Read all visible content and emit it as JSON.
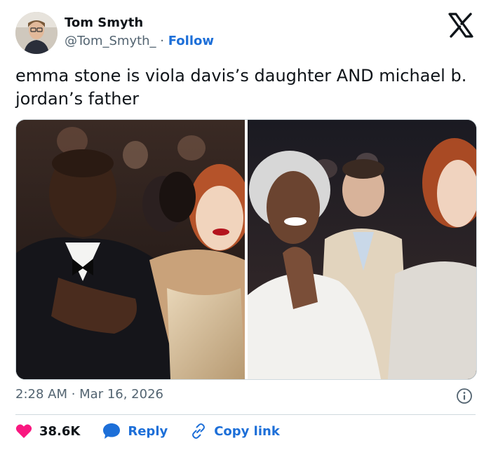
{
  "author": {
    "name": "Tom Smyth",
    "handle": "@Tom_Smyth_",
    "separator": " · ",
    "follow_label": "Follow"
  },
  "tweet": {
    "text": "emma stone is viola davis’s daughter AND michael b. jordan’s father"
  },
  "meta": {
    "timestamp": "2:28 AM · Mar 16, 2026"
  },
  "actions": {
    "like_count": "38.6K",
    "reply_label": "Reply",
    "copy_label": "Copy link"
  },
  "icons": [
    "x-logo-icon",
    "info-icon",
    "heart-icon",
    "reply-bubble-icon",
    "link-icon"
  ],
  "colors": {
    "accent": "#1d6fd8",
    "like": "#f91880",
    "text_secondary": "#536471"
  }
}
